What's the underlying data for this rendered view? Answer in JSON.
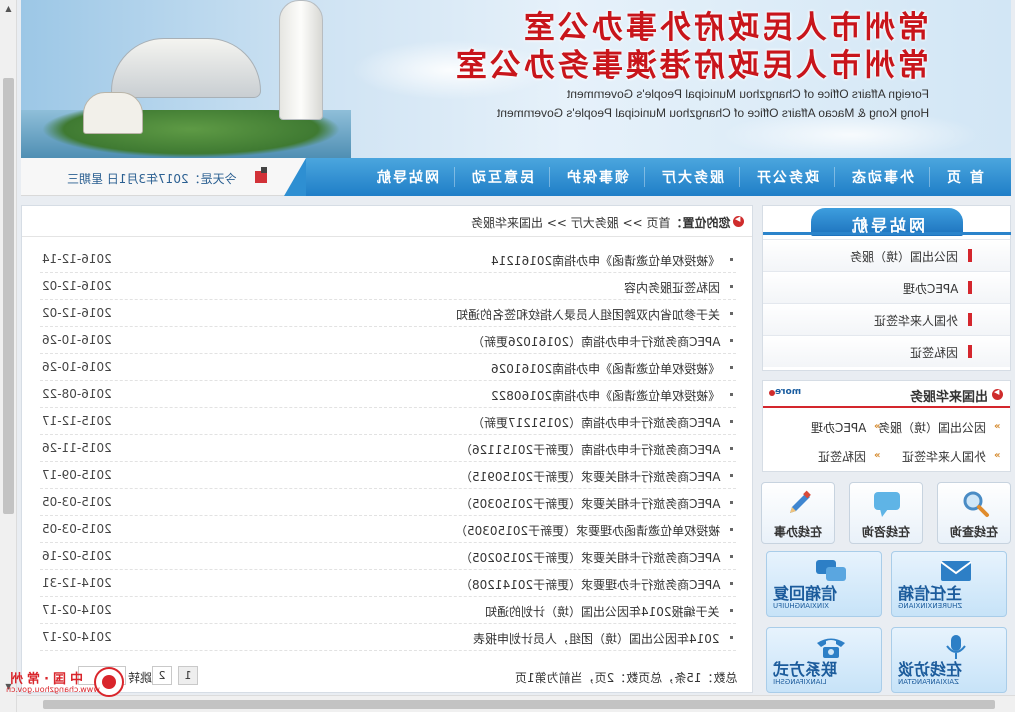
{
  "banner": {
    "title_cn_1": "常州市人民政府外事办公室",
    "title_cn_2": "常州市人民政府港澳事务办公室",
    "title_en_1": "Foreign Affairs Office of Changzhou Municipal People's Government",
    "title_en_2": "Hong Kong & Macao Affairs Office of Changzhou Municipal People's Government"
  },
  "nav": {
    "items": [
      "首  页",
      "外事动态",
      "政务公开",
      "服务大厅",
      "领事保护",
      "民意互动",
      "网站导航"
    ],
    "date_text": "今天是：2017年3月1日 星期三"
  },
  "location": {
    "label": "您的位置：",
    "path": "首页 >> 服务大厅 >> 出国来华服务"
  },
  "articles": [
    {
      "title": "《被授权单位邀请函》申办指南20161214",
      "date": "2016-12-14"
    },
    {
      "title": "因私签证服务内容",
      "date": "2016-12-02"
    },
    {
      "title": "关于参加省内双跨团组人员录入指纹和签名的通知",
      "date": "2016-12-02"
    },
    {
      "title": "APEC商务旅行卡申办指南（20161026更新）",
      "date": "2016-10-26"
    },
    {
      "title": "《被授权单位邀请函》申办指南20161026",
      "date": "2016-10-26"
    },
    {
      "title": "《被授权单位邀请函》申办指南20160822",
      "date": "2016-08-22"
    },
    {
      "title": "APEC商务旅行卡申办指南（20151217更新）",
      "date": "2015-12-17"
    },
    {
      "title": "APEC商务旅行卡申办指南（更新于20151126）",
      "date": "2015-11-26"
    },
    {
      "title": "APEC商务旅行卡相关要求（更新于20150915）",
      "date": "2015-09-17"
    },
    {
      "title": "APEC商务旅行卡相关要求（更新于20150305）",
      "date": "2015-03-05"
    },
    {
      "title": "被授权单位邀请函办理要求（更新于20150305）",
      "date": "2015-03-05"
    },
    {
      "title": "APEC商务旅行卡相关要求（更新于20150205）",
      "date": "2015-02-16"
    },
    {
      "title": "APEC商务旅行卡办理要求（更新于20141208）",
      "date": "2014-12-31"
    },
    {
      "title": "关于编报2014年因公出国（境）计划的通知",
      "date": "2014-02-17"
    },
    {
      "title": "2014年因公出国（境）团组，人员计划申报表",
      "date": "2014-02-17"
    }
  ],
  "pager": {
    "info": "总数：15条，总页数：2页，当前为第1页",
    "page1": "1",
    "page2": "2",
    "jump_label": "跳转"
  },
  "sidenav": {
    "title": "网站导航",
    "items": [
      "因公出国（境）服务",
      "APEC办理",
      "外国人来华签证",
      "因私签证"
    ]
  },
  "visit": {
    "title": "出国来华服务",
    "more": "more",
    "links": [
      "因公出国（境）服务",
      "APEC办理",
      "外国人来华签证",
      "因私签证"
    ]
  },
  "services": {
    "query": "在线查询",
    "consult": "在线咨询",
    "handle": "在线办事"
  },
  "big_buttons": {
    "director_mail": {
      "label": "主任信箱",
      "pinyin": "ZHURENXINXIANG"
    },
    "mail_reply": {
      "label": "信箱回复",
      "pinyin": "XINXIANGHUIFU"
    },
    "interview": {
      "label": "在线访谈",
      "pinyin": "ZAIXIANFANGTAN"
    },
    "contact": {
      "label": "联系方式",
      "pinyin": "LIANXIFANGSHI"
    }
  },
  "logo": {
    "text": "中国·常州",
    "url": "www.changzhou.gov.cn"
  },
  "colors": {
    "accent": "#1f7ec7",
    "brand_red": "#c8151b"
  }
}
